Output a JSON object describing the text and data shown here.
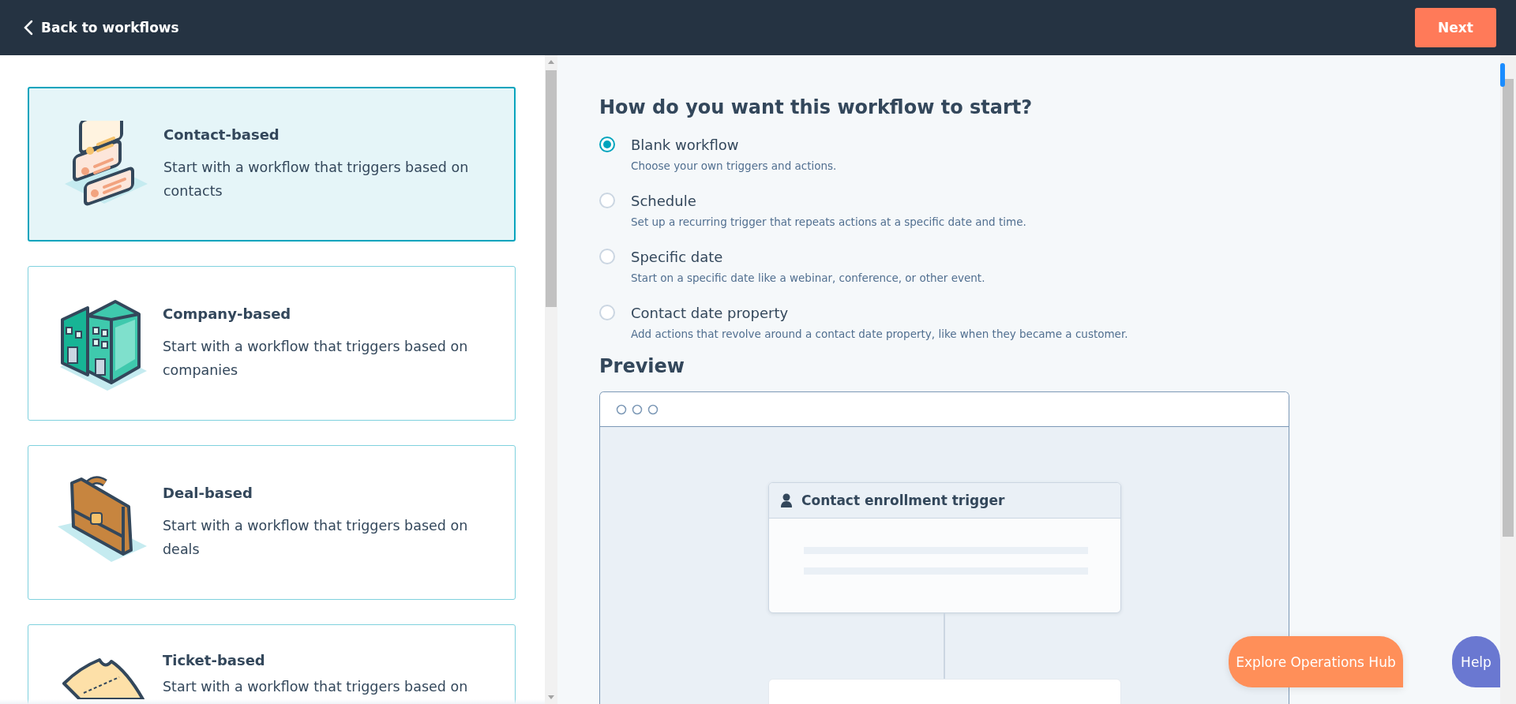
{
  "header": {
    "back_label": "Back to workflows",
    "next_button": "Next"
  },
  "workflow_types": [
    {
      "kind": "contact",
      "title": "Contact-based",
      "description": "Start with a workflow that triggers based on contacts",
      "selected": true
    },
    {
      "kind": "company",
      "title": "Company-based",
      "description": "Start with a workflow that triggers based on companies",
      "selected": false
    },
    {
      "kind": "deal",
      "title": "Deal-based",
      "description": "Start with a workflow that triggers based on deals",
      "selected": false
    },
    {
      "kind": "ticket",
      "title": "Ticket-based",
      "description": "Start with a workflow that triggers based on",
      "selected": false
    }
  ],
  "start": {
    "heading": "How do you want this workflow to start?",
    "options": [
      {
        "label": "Blank workflow",
        "description": "Choose your own triggers and actions.",
        "selected": true
      },
      {
        "label": "Schedule",
        "description": "Set up a recurring trigger that repeats actions at a specific date and time.",
        "selected": false
      },
      {
        "label": "Specific date",
        "description": "Start on a specific date like a webinar, conference, or other event.",
        "selected": false
      },
      {
        "label": "Contact date property",
        "description": "Add actions that revolve around a contact date property, like when they became a customer.",
        "selected": false
      }
    ]
  },
  "preview": {
    "heading": "Preview",
    "trigger_title": "Contact enrollment trigger"
  },
  "floating": {
    "explore_button": "Explore Operations Hub",
    "help_button": "Help"
  }
}
